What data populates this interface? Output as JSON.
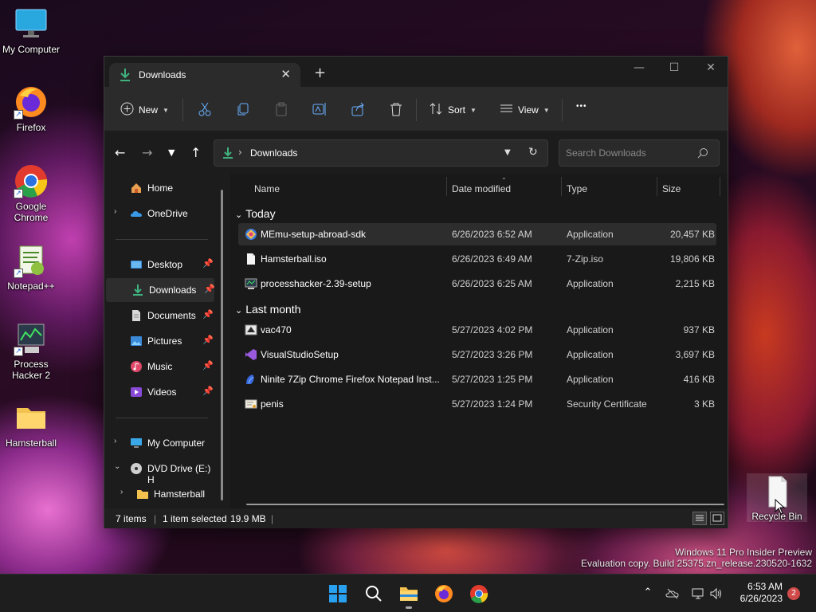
{
  "desktop": {
    "icons": [
      {
        "label": "My Computer"
      },
      {
        "label": "Firefox"
      },
      {
        "label": "Google Chrome"
      },
      {
        "label": "Notepad++"
      },
      {
        "label": "Process Hacker 2"
      },
      {
        "label": "Hamsterball"
      },
      {
        "label": "Recycle Bin"
      }
    ],
    "watermark_line1": "Windows 11 Pro Insider Preview",
    "watermark_line2": "Evaluation copy. Build 25375.zn_release.230520-1632"
  },
  "window": {
    "tab_title": "Downloads",
    "tab_close": "✕",
    "new_tab": "+",
    "controls": {
      "minimize": "—",
      "maximize": "☐",
      "close": "✕"
    },
    "toolbar": {
      "new_label": "New",
      "sort_label": "Sort",
      "view_label": "View",
      "more_label": "•••"
    },
    "address": {
      "crumb": "Downloads",
      "search_placeholder": "Search Downloads"
    },
    "nav": {
      "items": [
        {
          "label": "Home"
        },
        {
          "label": "OneDrive"
        },
        {
          "label": "Desktop"
        },
        {
          "label": "Downloads"
        },
        {
          "label": "Documents"
        },
        {
          "label": "Pictures"
        },
        {
          "label": "Music"
        },
        {
          "label": "Videos"
        },
        {
          "label": "My Computer"
        },
        {
          "label": "DVD Drive (E:) H"
        },
        {
          "label": "Hamsterball"
        }
      ]
    },
    "columns": {
      "name": "Name",
      "date": "Date modified",
      "type": "Type",
      "size": "Size"
    },
    "groups": {
      "today": "Today",
      "last_month": "Last month"
    },
    "files": [
      {
        "name": "MEmu-setup-abroad-sdk",
        "date": "6/26/2023 6:52 AM",
        "type": "Application",
        "size": "20,457 KB"
      },
      {
        "name": "Hamsterball.iso",
        "date": "6/26/2023 6:49 AM",
        "type": "7-Zip.iso",
        "size": "19,806 KB"
      },
      {
        "name": "processhacker-2.39-setup",
        "date": "6/26/2023 6:25 AM",
        "type": "Application",
        "size": "2,215 KB"
      },
      {
        "name": "vac470",
        "date": "5/27/2023 4:02 PM",
        "type": "Application",
        "size": "937 KB"
      },
      {
        "name": "VisualStudioSetup",
        "date": "5/27/2023 3:26 PM",
        "type": "Application",
        "size": "3,697 KB"
      },
      {
        "name": "Ninite 7Zip Chrome Firefox Notepad Inst...",
        "date": "5/27/2023 1:25 PM",
        "type": "Application",
        "size": "416 KB"
      },
      {
        "name": "penis",
        "date": "5/27/2023 1:24 PM",
        "type": "Security Certificate",
        "size": "3 KB"
      }
    ],
    "status": {
      "items": "7 items",
      "selected": "1 item selected",
      "selected_size": "19.9 MB"
    }
  },
  "taskbar": {
    "time": "6:53 AM",
    "date": "6/26/2023",
    "notification_count": "2"
  },
  "colors": {
    "accent_green": "#3fb37f",
    "folder_yellow": "#f2c14e",
    "window_bg": "#202020"
  }
}
